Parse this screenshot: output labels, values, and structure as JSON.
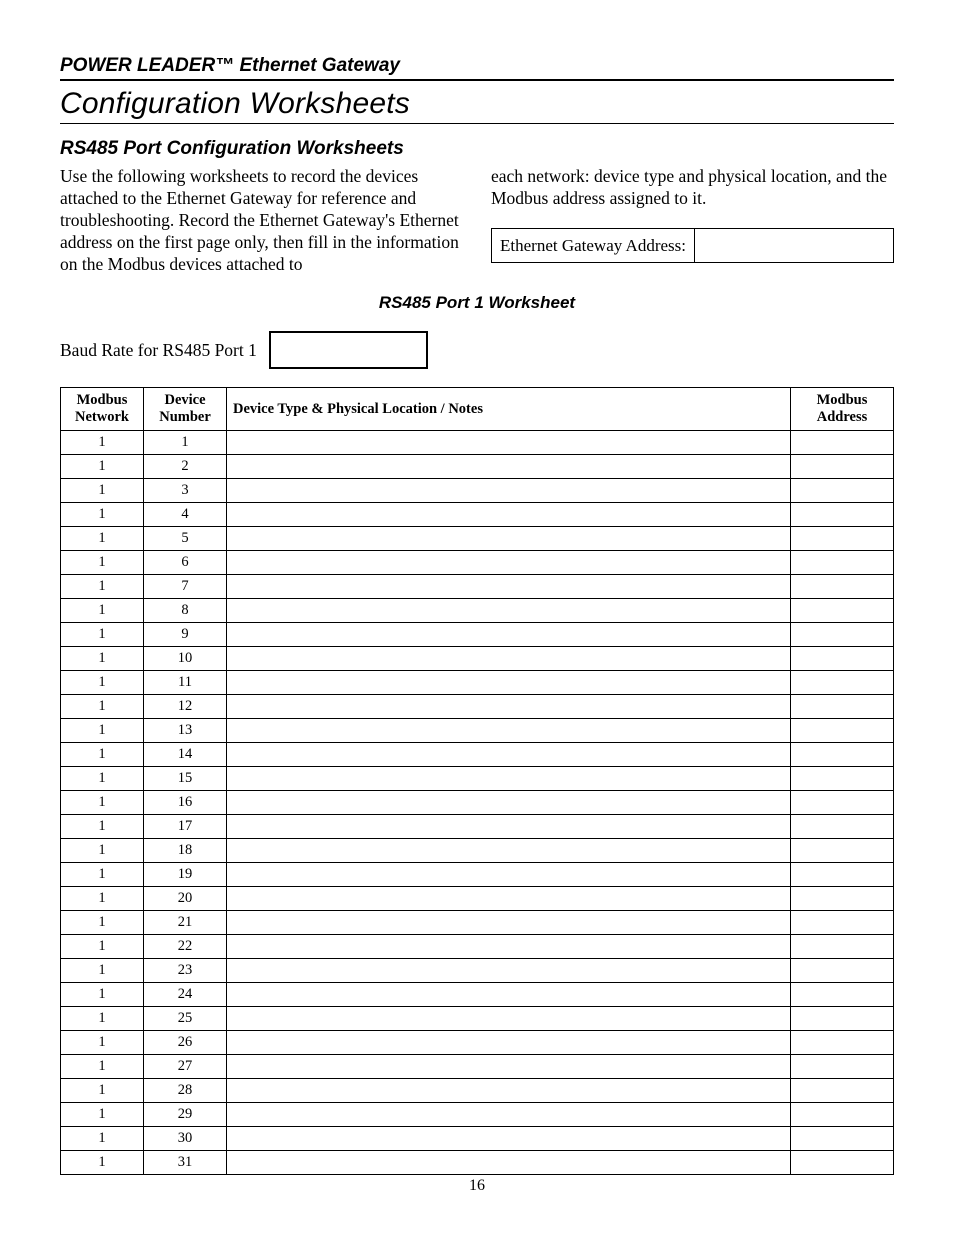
{
  "header": {
    "product": "POWER LEADER™ Ethernet Gateway",
    "section": "Configuration Worksheets"
  },
  "subsection": {
    "title": "RS485 Port Configuration Worksheets",
    "intro_col1": "Use the following worksheets to record the devices attached to the Ethernet Gateway for reference and troubleshooting. Record the Ethernet Gateway's Ethernet address on the first page only, then fill in the information on the Modbus devices attached to",
    "intro_col2": "each network: device type and physical location, and the Modbus address assigned to it.",
    "gateway_address_label": "Ethernet Gateway Address:",
    "gateway_address_value": ""
  },
  "worksheet": {
    "title": "RS485 Port 1 Worksheet",
    "baud_label": "Baud Rate for RS485 Port 1",
    "baud_value": "",
    "columns": {
      "c1a": "Modbus",
      "c1b": "Network",
      "c2a": "Device",
      "c2b": "Number",
      "c3": "Device Type & Physical Location / Notes",
      "c4a": "Modbus",
      "c4b": "Address"
    },
    "rows": [
      {
        "network": "1",
        "device": "1",
        "notes": "",
        "address": ""
      },
      {
        "network": "1",
        "device": "2",
        "notes": "",
        "address": ""
      },
      {
        "network": "1",
        "device": "3",
        "notes": "",
        "address": ""
      },
      {
        "network": "1",
        "device": "4",
        "notes": "",
        "address": ""
      },
      {
        "network": "1",
        "device": "5",
        "notes": "",
        "address": ""
      },
      {
        "network": "1",
        "device": "6",
        "notes": "",
        "address": ""
      },
      {
        "network": "1",
        "device": "7",
        "notes": "",
        "address": ""
      },
      {
        "network": "1",
        "device": "8",
        "notes": "",
        "address": ""
      },
      {
        "network": "1",
        "device": "9",
        "notes": "",
        "address": ""
      },
      {
        "network": "1",
        "device": "10",
        "notes": "",
        "address": ""
      },
      {
        "network": "1",
        "device": "11",
        "notes": "",
        "address": ""
      },
      {
        "network": "1",
        "device": "12",
        "notes": "",
        "address": ""
      },
      {
        "network": "1",
        "device": "13",
        "notes": "",
        "address": ""
      },
      {
        "network": "1",
        "device": "14",
        "notes": "",
        "address": ""
      },
      {
        "network": "1",
        "device": "15",
        "notes": "",
        "address": ""
      },
      {
        "network": "1",
        "device": "16",
        "notes": "",
        "address": ""
      },
      {
        "network": "1",
        "device": "17",
        "notes": "",
        "address": ""
      },
      {
        "network": "1",
        "device": "18",
        "notes": "",
        "address": ""
      },
      {
        "network": "1",
        "device": "19",
        "notes": "",
        "address": ""
      },
      {
        "network": "1",
        "device": "20",
        "notes": "",
        "address": ""
      },
      {
        "network": "1",
        "device": "21",
        "notes": "",
        "address": ""
      },
      {
        "network": "1",
        "device": "22",
        "notes": "",
        "address": ""
      },
      {
        "network": "1",
        "device": "23",
        "notes": "",
        "address": ""
      },
      {
        "network": "1",
        "device": "24",
        "notes": "",
        "address": ""
      },
      {
        "network": "1",
        "device": "25",
        "notes": "",
        "address": ""
      },
      {
        "network": "1",
        "device": "26",
        "notes": "",
        "address": ""
      },
      {
        "network": "1",
        "device": "27",
        "notes": "",
        "address": ""
      },
      {
        "network": "1",
        "device": "28",
        "notes": "",
        "address": ""
      },
      {
        "network": "1",
        "device": "29",
        "notes": "",
        "address": ""
      },
      {
        "network": "1",
        "device": "30",
        "notes": "",
        "address": ""
      },
      {
        "network": "1",
        "device": "31",
        "notes": "",
        "address": ""
      }
    ]
  },
  "page_number": "16"
}
